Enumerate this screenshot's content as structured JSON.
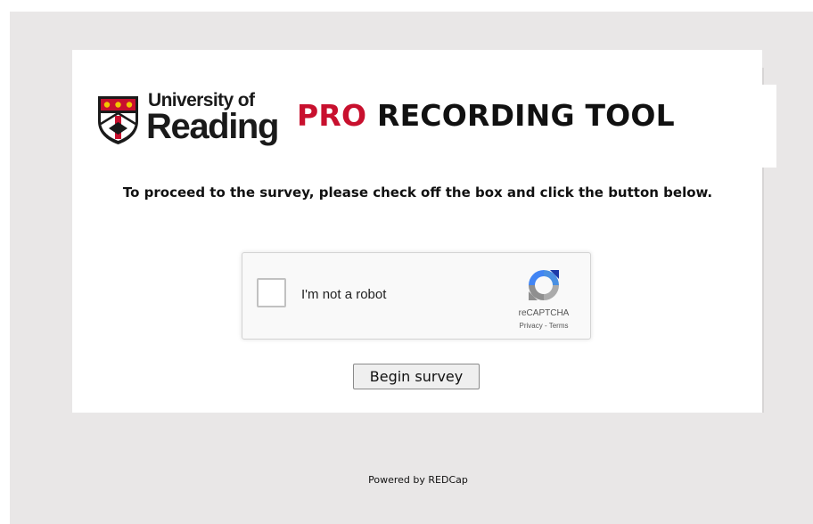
{
  "header": {
    "logo_line1": "University of",
    "logo_line2": "Reading",
    "title_accent": "PRO",
    "title_main": "RECORDING TOOL",
    "title_accent_color": "#c8102e"
  },
  "instruction": "To proceed to the survey, please check off the box and click the button below.",
  "recaptcha": {
    "label": "I'm not a robot",
    "brand": "reCAPTCHA",
    "privacy_link": "Privacy",
    "separator": " - ",
    "terms_link": "Terms",
    "checked": false,
    "logo_icon": "recaptcha-logo-icon"
  },
  "actions": {
    "begin_label": "Begin survey"
  },
  "footer": {
    "text": "Powered by REDCap"
  }
}
